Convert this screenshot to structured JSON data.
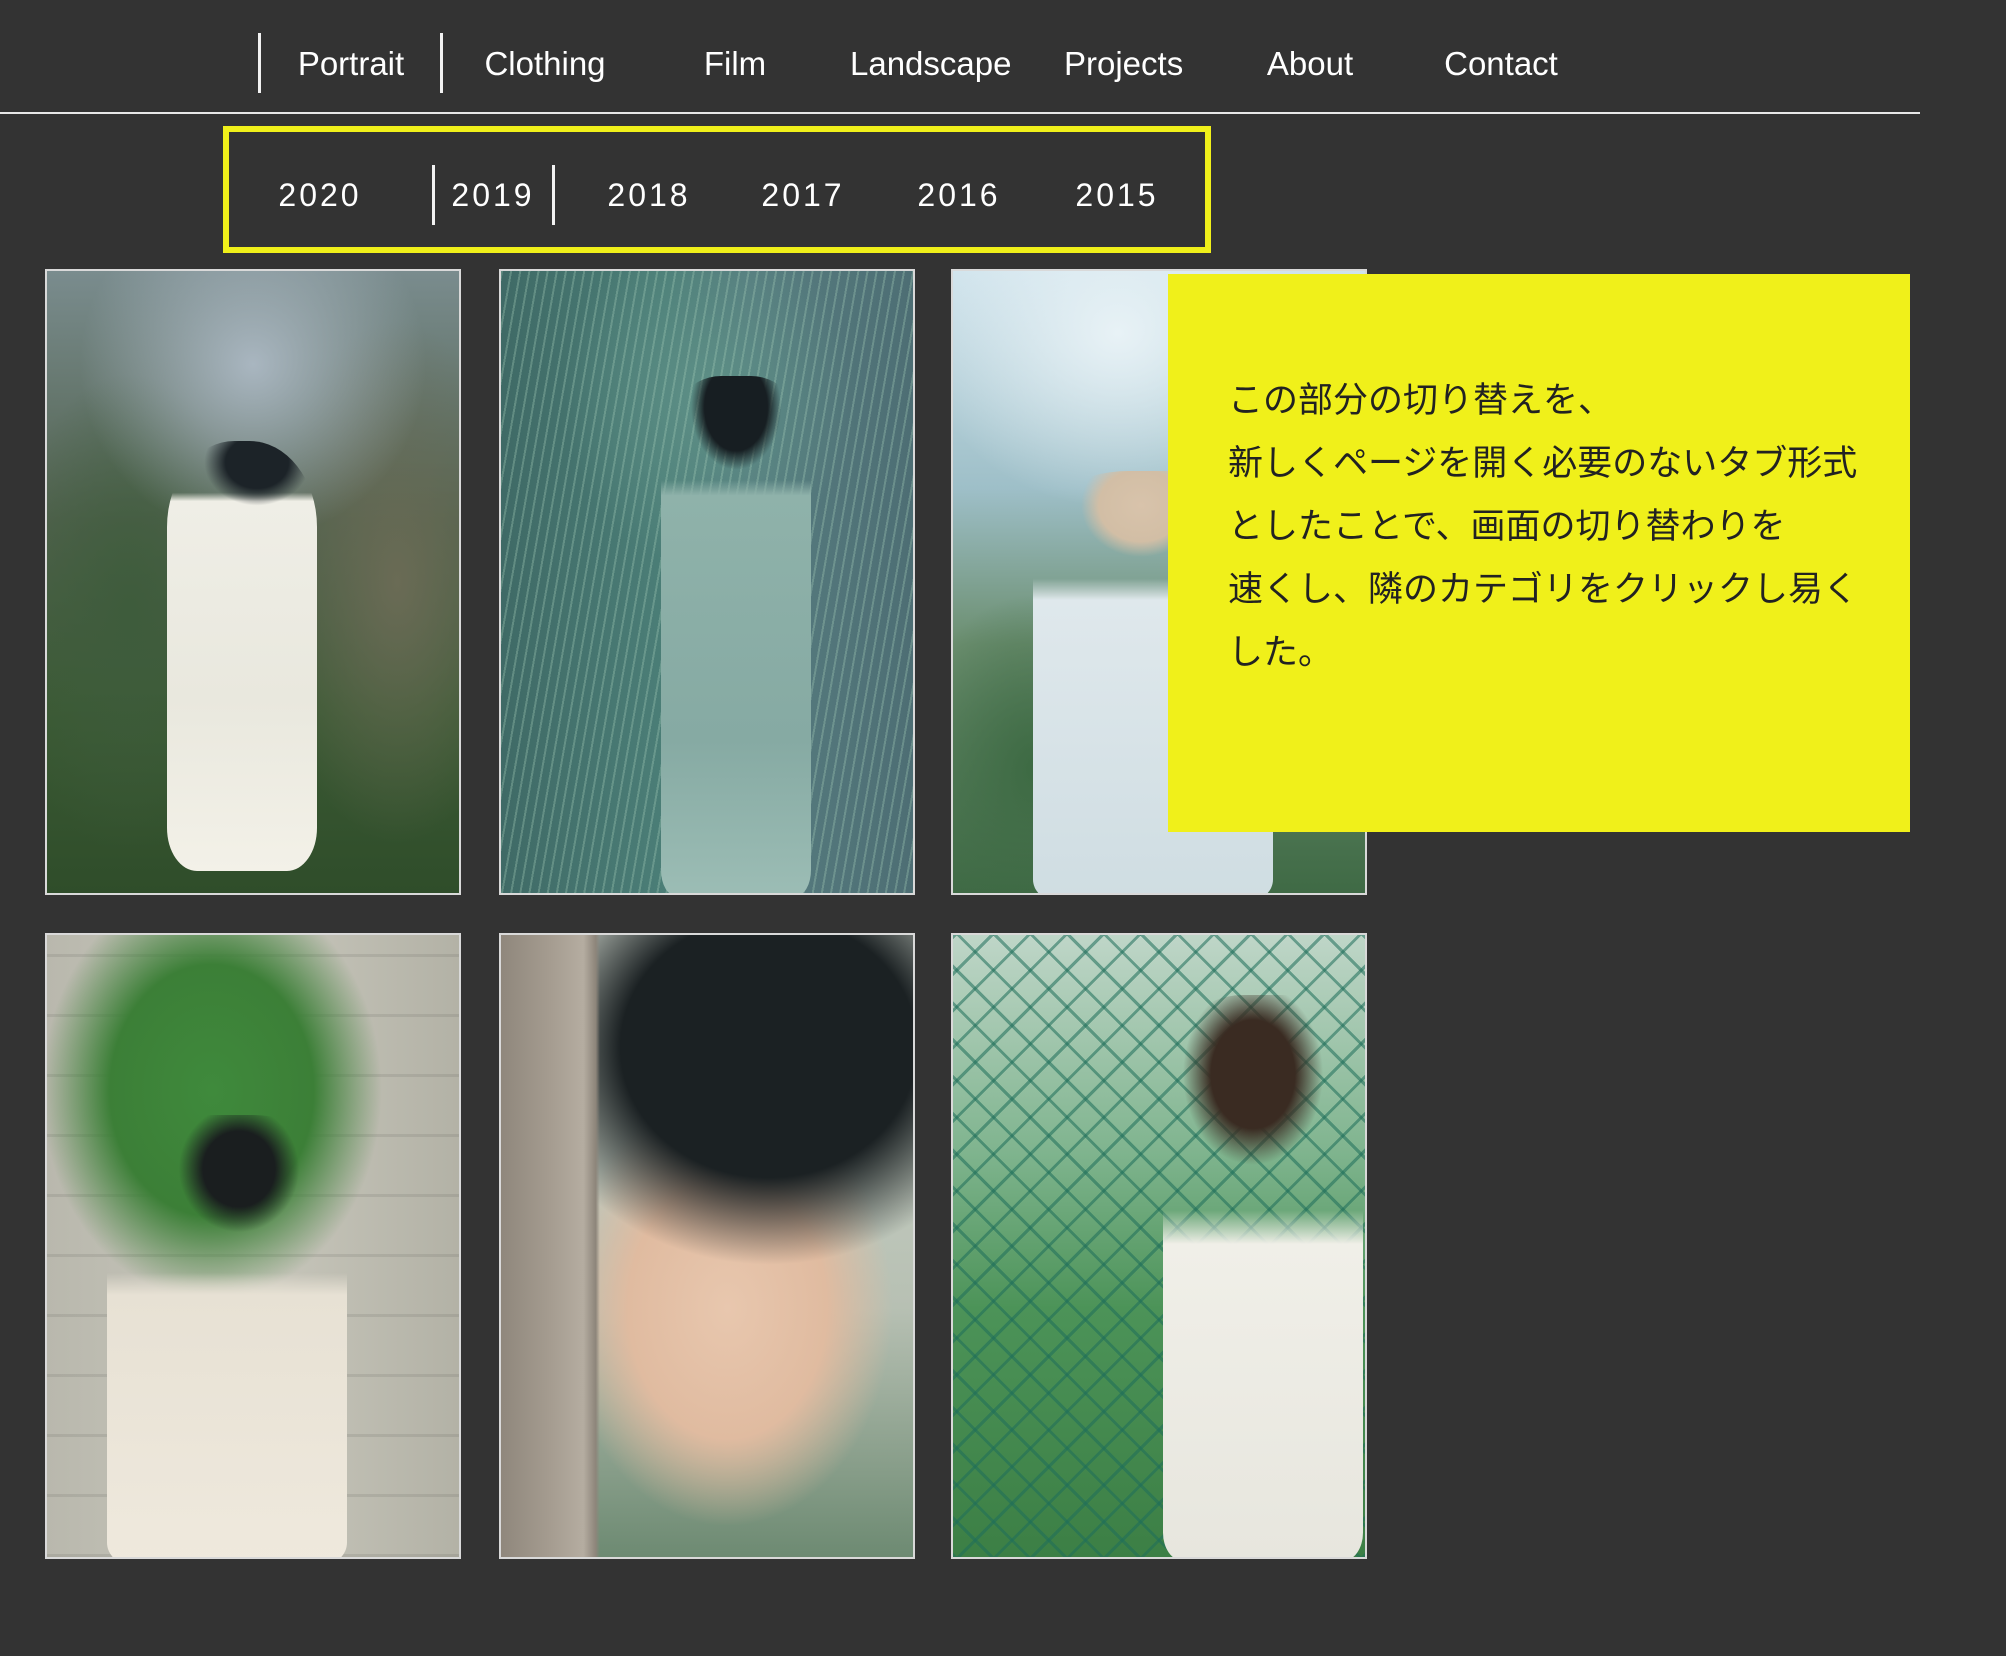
{
  "nav": {
    "items": [
      {
        "label": "Portrait"
      },
      {
        "label": "Clothing"
      },
      {
        "label": "Film"
      },
      {
        "label": "Landscape"
      },
      {
        "label": "Projects"
      },
      {
        "label": "About"
      },
      {
        "label": "Contact"
      }
    ]
  },
  "year_tabs": {
    "items": [
      {
        "label": "2020"
      },
      {
        "label": "2019"
      },
      {
        "label": "2018"
      },
      {
        "label": "2017"
      },
      {
        "label": "2016"
      },
      {
        "label": "2015"
      }
    ],
    "selected": "2019",
    "highlight_color": "#f0f01a"
  },
  "gallery": {
    "photos": [
      {
        "subject": "woman in white dress among shrubs"
      },
      {
        "subject": "woman in teal dress under long grass"
      },
      {
        "subject": "blonde woman among plants"
      },
      {
        "subject": "woman under hanging rosemary against stone wall"
      },
      {
        "subject": "close-up of person leaning on tree trunk"
      },
      {
        "subject": "woman at chain-link fence"
      }
    ]
  },
  "note": {
    "tag": "",
    "background_color": "#f0f01a",
    "lines": [
      "この部分の切り替えを、",
      "新しくページを開く必要のないタブ形式",
      "としたことで、画面の切り替わりを",
      "速くし、隣のカテゴリをクリックし易く",
      "した。"
    ]
  },
  "colors": {
    "page_background": "#333333",
    "text": "#ffffff",
    "divider": "#e8e8e8"
  }
}
